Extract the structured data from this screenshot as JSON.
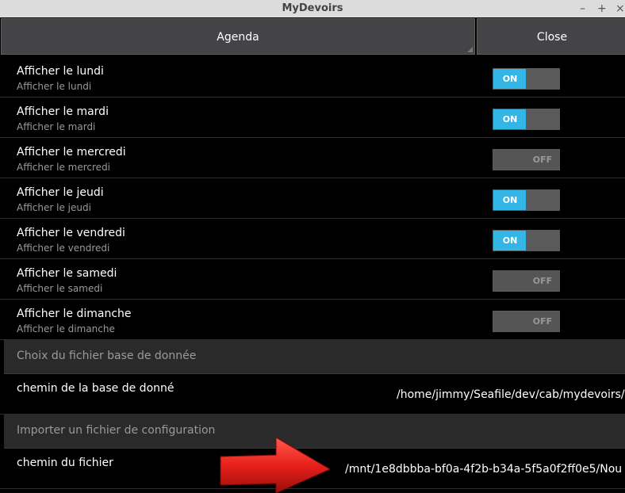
{
  "window": {
    "title": "MyDevoirs",
    "minimize": "–",
    "maximize": "+",
    "close": "×"
  },
  "tabs": {
    "agenda": "Agenda",
    "close": "Close"
  },
  "day_settings": [
    {
      "title": "Afficher le lundi",
      "subtitle": "Afficher le lundi",
      "state": "ON",
      "on": true
    },
    {
      "title": "Afficher le mardi",
      "subtitle": "Afficher le mardi",
      "state": "ON",
      "on": true
    },
    {
      "title": "Afficher le mercredi",
      "subtitle": "Afficher le mercredi",
      "state": "OFF",
      "on": false
    },
    {
      "title": "Afficher le jeudi",
      "subtitle": "Afficher le jeudi",
      "state": "ON",
      "on": true
    },
    {
      "title": "Afficher le vendredi",
      "subtitle": "Afficher le vendredi",
      "state": "ON",
      "on": true
    },
    {
      "title": "Afficher le samedi",
      "subtitle": "Afficher le samedi",
      "state": "OFF",
      "on": false
    },
    {
      "title": "Afficher le dimanche",
      "subtitle": "Afficher le dimanche",
      "state": "OFF",
      "on": false
    }
  ],
  "db_section": {
    "header": "Choix du fichier base de donnée",
    "label": "chemin de la base de donné",
    "value": "/home/jimmy/Seafile/dev/cab/mydevoirs/h"
  },
  "import_section": {
    "header": "Importer un fichier de configuration",
    "label": "chemin du fichier",
    "value": "/mnt/1e8dbbba-bf0a-4f2b-b34a-5f5a0f2ff0e5/Nou"
  },
  "colors": {
    "switch_on": "#33b5e5",
    "arrow": "#e8201c",
    "background": "#000000"
  }
}
